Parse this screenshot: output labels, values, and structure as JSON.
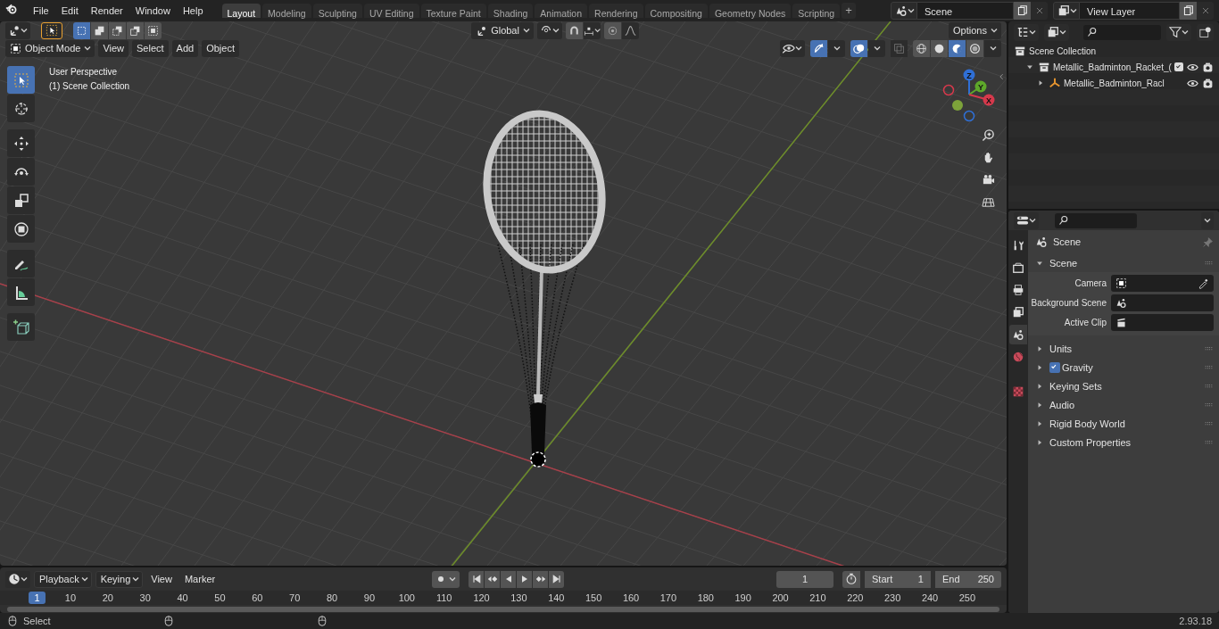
{
  "menu_bar": {
    "items": [
      "File",
      "Edit",
      "Render",
      "Window",
      "Help"
    ]
  },
  "workspace_tabs": [
    {
      "label": "Layout",
      "selected": true
    },
    {
      "label": "Modeling",
      "selected": false
    },
    {
      "label": "Sculpting",
      "selected": false
    },
    {
      "label": "UV Editing",
      "selected": false
    },
    {
      "label": "Texture Paint",
      "selected": false
    },
    {
      "label": "Shading",
      "selected": false
    },
    {
      "label": "Animation",
      "selected": false
    },
    {
      "label": "Rendering",
      "selected": false
    },
    {
      "label": "Compositing",
      "selected": false
    },
    {
      "label": "Geometry Nodes",
      "selected": false
    },
    {
      "label": "Scripting",
      "selected": false
    }
  ],
  "add_workspace": "+",
  "scene_selector": {
    "value": "Scene"
  },
  "view_layer_selector": {
    "value": "View Layer"
  },
  "tool_header": {
    "selection_modes": [
      {
        "kind": "set",
        "selected": true
      },
      {
        "kind": "extend",
        "selected": false
      },
      {
        "kind": "subtract",
        "selected": false
      },
      {
        "kind": "invert",
        "selected": false
      },
      {
        "kind": "intersect",
        "selected": false
      }
    ],
    "orientation": "Global",
    "options": "Options"
  },
  "viewport_header": {
    "mode": "Object Mode",
    "menus": [
      "View",
      "Select",
      "Add",
      "Object"
    ],
    "gizmos_on": true,
    "overlays_on": true,
    "shading_modes": [
      {
        "kind": "wireframe",
        "selected": false
      },
      {
        "kind": "solid",
        "selected": false
      },
      {
        "kind": "material",
        "selected": true
      },
      {
        "kind": "rendered",
        "selected": false
      }
    ]
  },
  "toolbar": [
    {
      "kind": "select",
      "selected": true
    },
    {
      "kind": "cursor",
      "selected": false
    },
    {
      "kind": "move",
      "selected": false
    },
    {
      "kind": "rotate",
      "selected": false
    },
    {
      "kind": "scale",
      "selected": false
    },
    {
      "kind": "transform",
      "selected": false
    },
    {
      "kind": "annotate",
      "selected": false
    },
    {
      "kind": "measure",
      "selected": false
    },
    {
      "kind": "add-cube",
      "selected": false
    }
  ],
  "viewport": {
    "view_name": "User Perspective",
    "collection": "(1) Scene Collection",
    "axes": [
      {
        "label": "Z"
      },
      {
        "label": "Y"
      },
      {
        "label": "X"
      }
    ]
  },
  "outliner": {
    "items": [
      {
        "label": "Scene Collection",
        "kind": "scene",
        "children": [
          {
            "label": "Metallic_Badminton_Racket_(",
            "kind": "collection",
            "expanded": true,
            "checked": true,
            "children": [
              {
                "label": "Metallic_Badminton_Racl",
                "kind": "object",
                "expanded": false
              }
            ]
          }
        ]
      }
    ]
  },
  "properties": {
    "tabs": [
      {
        "kind": "tool",
        "selected": false
      },
      {
        "kind": "render",
        "selected": false
      },
      {
        "kind": "output",
        "selected": false
      },
      {
        "kind": "view-layer",
        "selected": false
      },
      {
        "kind": "scene",
        "selected": true
      },
      {
        "kind": "world",
        "selected": false
      },
      {
        "kind": "texture",
        "selected": false
      }
    ],
    "context": "Scene",
    "panel": {
      "title": "Scene",
      "expanded": true,
      "fields": [
        {
          "label": "Camera",
          "kind": "camera"
        },
        {
          "label": "Background Scene",
          "kind": "scene"
        },
        {
          "label": "Active Clip",
          "kind": "clip"
        }
      ]
    },
    "sections": [
      {
        "title": "Units",
        "kind": "plain",
        "expanded": false
      },
      {
        "title": "Gravity",
        "kind": "checkbox",
        "checked": true,
        "expanded": false
      },
      {
        "title": "Keying Sets",
        "kind": "plain",
        "expanded": false
      },
      {
        "title": "Audio",
        "kind": "plain",
        "expanded": false
      },
      {
        "title": "Rigid Body World",
        "kind": "plain",
        "expanded": false
      },
      {
        "title": "Custom Properties",
        "kind": "plain",
        "expanded": false
      }
    ]
  },
  "timeline": {
    "menus": [
      {
        "label": "Playback",
        "kind": "dropdown"
      },
      {
        "label": "Keying",
        "kind": "dropdown"
      },
      {
        "label": "View",
        "kind": "menu"
      },
      {
        "label": "Marker",
        "kind": "menu"
      }
    ],
    "current_frame": "1",
    "start_label": "Start",
    "start": "1",
    "end_label": "End",
    "end": "250",
    "playhead": "1",
    "ticks": [
      "10",
      "20",
      "30",
      "40",
      "50",
      "60",
      "70",
      "80",
      "90",
      "100",
      "110",
      "120",
      "130",
      "140",
      "150",
      "160",
      "170",
      "180",
      "190",
      "200",
      "210",
      "220",
      "230",
      "240",
      "250"
    ]
  },
  "status_bar": {
    "hint": "Select",
    "version": "2.93.18"
  }
}
